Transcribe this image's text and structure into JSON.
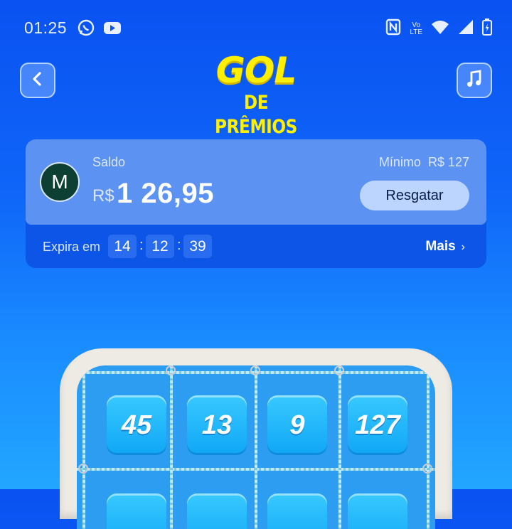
{
  "status_bar": {
    "time": "01:25",
    "left_icons": [
      "whatsapp-icon",
      "youtube-icon"
    ],
    "right_icons": [
      "nfc-icon",
      "volte-icon",
      "wifi-icon",
      "signal-icon",
      "battery-icon"
    ],
    "volte_label_1": "Vo",
    "volte_label_2": "LTE"
  },
  "header": {
    "logo_line1": "GOL",
    "logo_line2": "DE PRÊMIOS",
    "logo_color": "#ffef00"
  },
  "balance": {
    "avatar_initial": "M",
    "label": "Saldo",
    "currency": "R$",
    "amount": "1 26,95",
    "minimum_label": "Mínimo",
    "minimum_value": "R$ 127",
    "redeem_button": "Resgatar",
    "expires_label": "Expira em",
    "timer": {
      "hours": "14",
      "minutes": "12",
      "seconds": "39"
    },
    "timer_separator": ":",
    "more_label": "Mais",
    "more_chevron": "›"
  },
  "goal": {
    "tiles": [
      "45",
      "13",
      "9",
      "127"
    ]
  },
  "colors": {
    "background_top": "#0a52f2",
    "background_bottom": "#22a6ff",
    "card_top": "#5c93f3",
    "card_bottom": "#0d55e6",
    "button": "#bcd5ff",
    "tile": "#10a6f6"
  }
}
